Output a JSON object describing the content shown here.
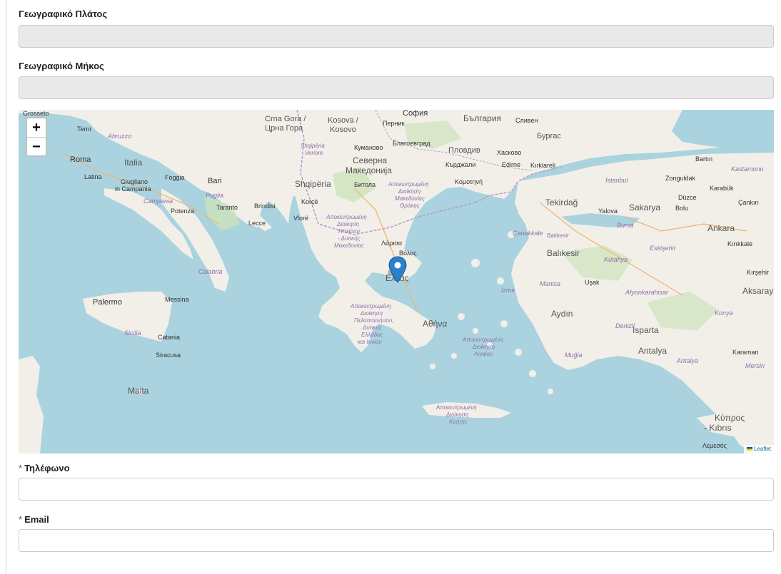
{
  "form": {
    "latitude_label": "Γεωγραφικό Πλάτος",
    "latitude_value": "",
    "longitude_label": "Γεωγραφικό Μήκος",
    "longitude_value": "",
    "phone_label": "Τηλέφωνο",
    "phone_value": "",
    "email_label": "Email",
    "email_value": "",
    "required_mark": "*"
  },
  "map": {
    "zoom_in": "+",
    "zoom_out": "−",
    "attribution": "Leaflet",
    "marker_icon": "map-pin-icon",
    "places": {
      "grosseto": "Grosseto",
      "terni": "Terni",
      "abruzzo": "Abruzzo",
      "roma": "Roma",
      "italia": "Italia",
      "latina": "Latina",
      "giugliano": "Giugliano",
      "in_campania": "in Campania",
      "foggia": "Foggia",
      "bari": "Bari",
      "campania": "Campania",
      "puglia": "Puglia",
      "potenza": "Potenza",
      "taranto": "Taranto",
      "brindisi": "Brindisi",
      "lecce": "Lecce",
      "calabria": "Calabria",
      "palermo": "Palermo",
      "messina": "Messina",
      "sicilia": "Sicilia",
      "catania": "Catania",
      "siracusa": "Siracusa",
      "malta": "Malta",
      "crna_gora": "Crna Gora /",
      "crna_gora_cyr": "Црна Гора",
      "kosova": "Kosova /",
      "kosovo": "Kosovo",
      "shqiperia_verior": "Shqipëria",
      "verior": "Veriore",
      "shqiperia": "Shqipëria",
      "korce": "Korçë",
      "vlore": "Vlorë",
      "kumanovo": "Куманово",
      "severna": "Северна",
      "makedonija": "Македонија",
      "bitola": "Битола",
      "sofia": "София",
      "pernik": "Перник",
      "blagoevgrad": "Благоевград",
      "bulgaria": "България",
      "sliven": "Сливен",
      "burgas": "Бургас",
      "plovdiv": "Пловдив",
      "haskovo": "Хасково",
      "kardzhali": "Кърджали",
      "edirne": "Edirne",
      "kirklareli": "Kırklareli",
      "komotini": "Κομοτηνή",
      "amth_line1": "Αποκεντρωμένη",
      "amth_line2": "Διοίκηση",
      "amth_line3": "Μακεδονίας",
      "amth_line4": "Θράκης",
      "ahd_line1": "Αποκεντρωμένη",
      "ahd_line2": "Διοίκηση",
      "ahd_line3": "Ηπείρου",
      "ahd_line4": "- Δυτικής",
      "ahd_line5": "Μακεδονίας",
      "larisa": "Λάρισα",
      "volos": "Βόλος",
      "ellada": "Ελλάς",
      "apd_line1": "Αποκεντρωμένη",
      "apd_line2": "Διοίκηση",
      "apd_line3": "Πελοποννήσου,",
      "apd_line4": "Δυτικής",
      "apd_line5": "Ελλάδας",
      "apd_line6": "και Ιονίου",
      "athina": "Αθήνα",
      "aai_line1": "Αποκεντρωμένη",
      "aai_line2": "Διοίκηση",
      "aai_line3": "Αιγαίου",
      "ak_line1": "Αποκεντρωμένη",
      "ak_line2": "Διοίκηση",
      "ak_line3": "Κρήτης",
      "istanbul": "İstanbul",
      "tekirdag": "Tekirdağ",
      "bartin": "Bartın",
      "kastamonu": "Kastamonu",
      "zonguldak": "Zonguldak",
      "karabuk": "Karabük",
      "duzce": "Düzce",
      "sakarya": "Sakarya",
      "yalova": "Yalova",
      "bolu": "Bolu",
      "cankiri": "Çankırı",
      "bursa": "Bursa",
      "canakkale": "Çanakkale",
      "balikesir_region": "Balıkesir",
      "balikesir": "Balıkesir",
      "eskisehir": "Eskişehir",
      "ankara": "Ankara",
      "kirikkale": "Kırıkkale",
      "kutahya": "Kütahya",
      "kirsehir": "Kırşehir",
      "izmir": "İzmir",
      "manisa": "Manisa",
      "usak": "Uşak",
      "afyonkarahisar": "Afyonkarahisar",
      "aksaray": "Aksaray",
      "aydin": "Aydın",
      "denizli": "Denizli",
      "isparta": "Isparta",
      "konya": "Konya",
      "antalya": "Antalya",
      "antalya_region": "Antalya",
      "mugla": "Muğla",
      "karaman": "Karaman",
      "mersin": "Mersin",
      "kypros": "Κύπρος",
      "kibris": "- Kıbrıs",
      "lemesos": "Λεμεσός"
    }
  }
}
